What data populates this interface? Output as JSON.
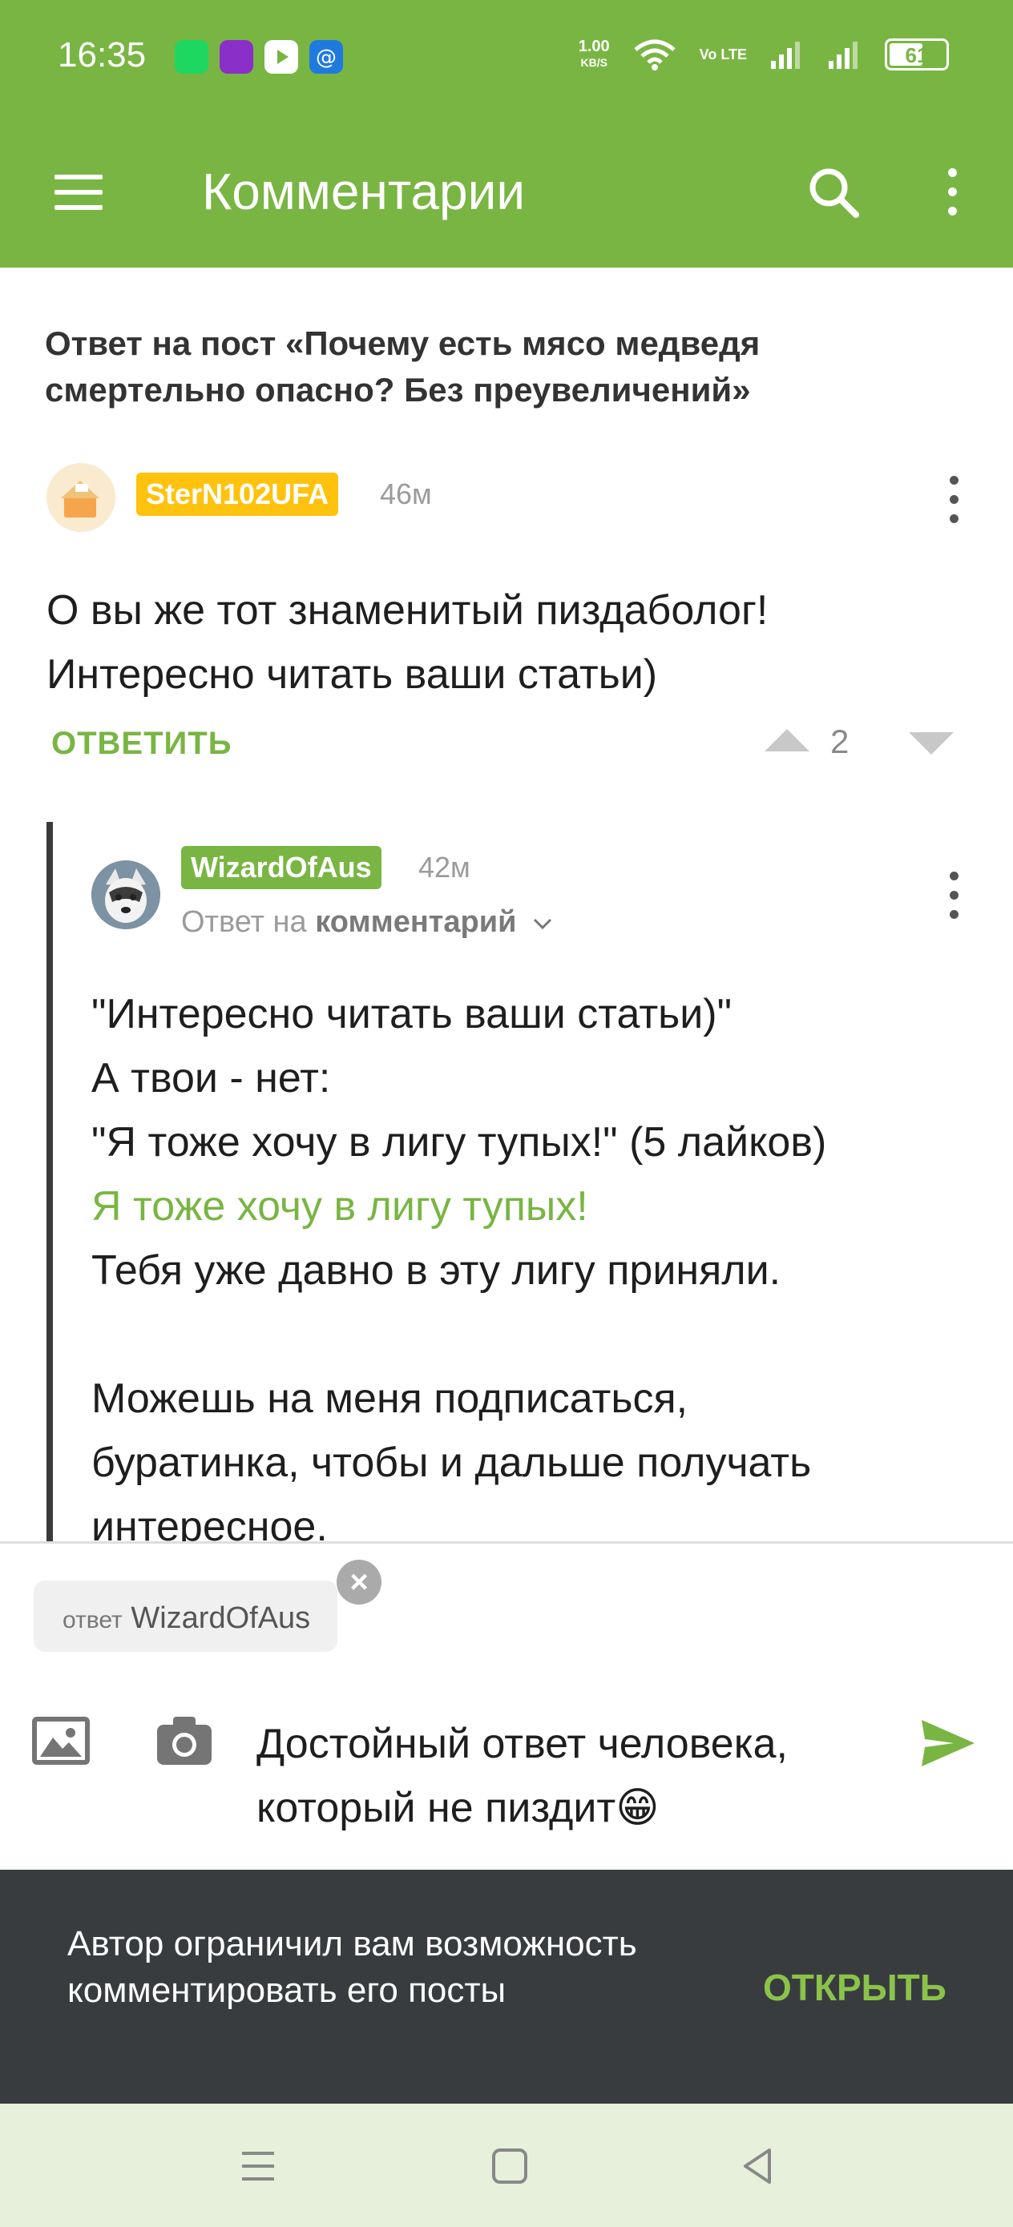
{
  "status_bar": {
    "time": "16:35",
    "net_speed_value": "1.00",
    "net_speed_unit": "KB/S",
    "volte": "Vo LTE",
    "battery": "61",
    "battery_level": 0.61
  },
  "app_bar": {
    "title": "Комментарии"
  },
  "post": {
    "title": "Ответ на пост «Почему есть мясо медведя смертельно опасно? Без преувеличений»"
  },
  "comment1": {
    "author": "SterN102UFA",
    "time": "46м",
    "text": "О вы же тот знаменитый пиздаболог! Интересно читать ваши статьи)",
    "reply_label": "ОТВЕТИТЬ",
    "rating": "2"
  },
  "comment2": {
    "author": "WizardOfAus",
    "time": "42м",
    "reply_prefix": "Ответ на",
    "reply_target": "комментарий",
    "lines": [
      "\"Интересно читать ваши статьи)\"",
      "А твои - нет:",
      "\"Я тоже хочу в лигу тупых!\" (5 лайков)",
      "Я тоже хочу в лигу тупых!",
      "Тебя уже давно в эту лигу приняли.",
      "",
      "Можешь на меня подписаться,",
      "буратинка, чтобы и дальше получать",
      "интересное."
    ]
  },
  "composer": {
    "reply_chip_prefix": "ответ",
    "reply_chip_name": "WizardOfAus",
    "input_text": "Достойный ответ человека, который не пиздит😁"
  },
  "banner": {
    "text": "Автор ограничил вам возможность комментировать его посты",
    "action": "ОТКРЫТЬ"
  },
  "colors": {
    "brand_green": "#79b543",
    "link_green": "#79b543",
    "author_badge_orange": "#ffc20e",
    "banner_bg": "#383c3f",
    "navbar_bg": "#e6f0db"
  },
  "icons": {
    "menu": "hamburger-icon",
    "search": "search-icon",
    "more": "more-vert-icon",
    "image": "image-icon",
    "camera": "camera-icon",
    "send": "send-icon",
    "close": "close-icon",
    "chevron": "chevron-down-icon"
  }
}
